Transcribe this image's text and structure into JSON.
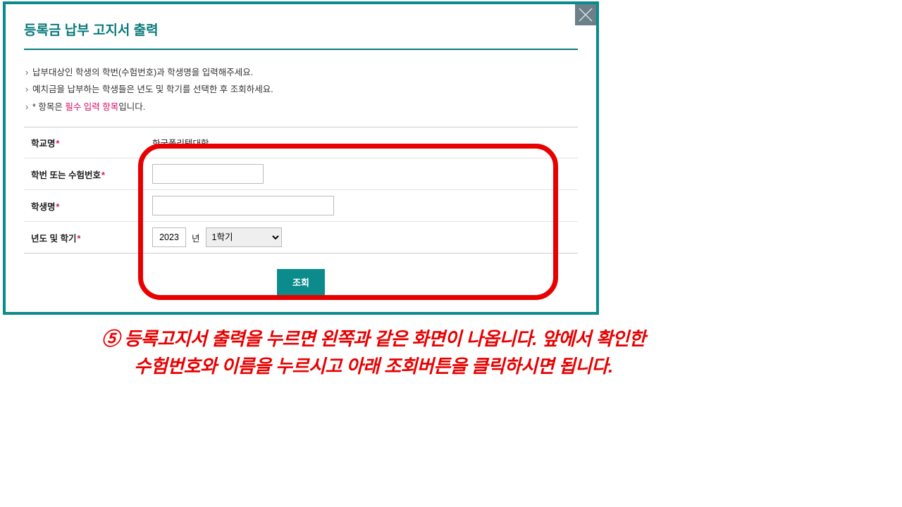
{
  "dialog": {
    "title": "등록금 납부 고지서 출력",
    "notes": {
      "line1": "납부대상인 학생의 학번(수험번호)과 학생명을 입력해주세요.",
      "line2": "예치금을 납부하는 학생들은 년도 및 학기를 선택한 후 조회하세요.",
      "line3_prefix": "* 항목은 ",
      "line3_pink": "필수 입력 항목",
      "line3_suffix": "입니다."
    },
    "form": {
      "school_label": "학교명",
      "school_value": "한국폴리텍대학",
      "id_label": "학번 또는 수험번호",
      "id_value": "",
      "name_label": "학생명",
      "name_value": "",
      "term_label": "년도 및 학기",
      "year_value": "2023",
      "year_unit": "년",
      "semester_value": "1학기"
    },
    "submit": "조회"
  },
  "caption": {
    "line1": "⑤ 등록고지서 출력을 누르면 왼쪽과 같은 화면이 나옵니다. 앞에서 확인한",
    "line2": "수험번호와 이름을 누르시고 아래 조회버튼을 클릭하시면 됩니다."
  }
}
